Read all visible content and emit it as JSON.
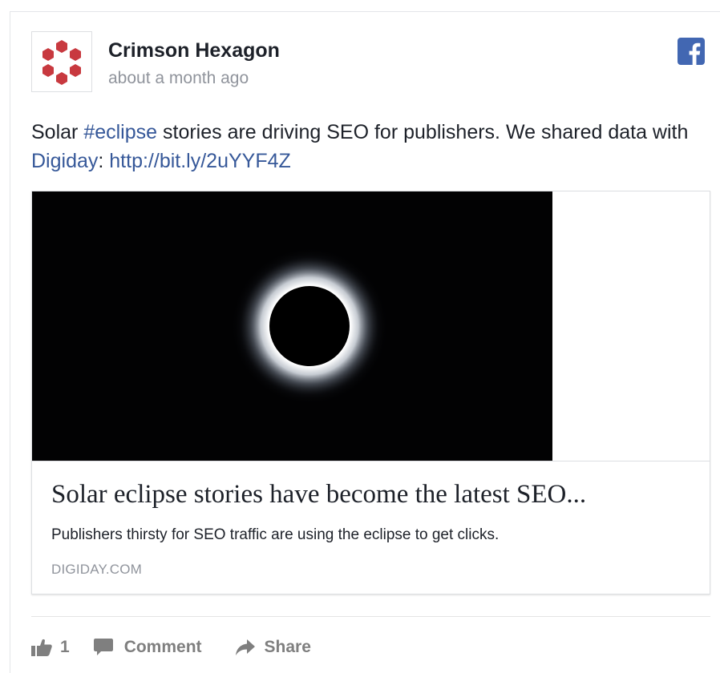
{
  "post": {
    "author": "Crimson Hexagon",
    "timestamp": "about a month ago",
    "text": {
      "part1": "Solar ",
      "hashtag": "#eclipse",
      "part2": " stories are driving SEO for publishers. We shared data with ",
      "mention": "Digiday",
      "part3": ": ",
      "link": "http://bit.ly/2uYYF4Z"
    },
    "source_icon": "facebook-icon",
    "avatar_icon": "crimson-hexagon-logo"
  },
  "link_card": {
    "image": "solar-eclipse-photo",
    "title": "Solar eclipse stories have become the latest SEO...",
    "description": "Publishers thirsty for SEO traffic are using the eclipse to get clicks.",
    "domain": "DIGIDAY.COM"
  },
  "actions": {
    "like_count": "1",
    "comment_label": "Comment",
    "share_label": "Share",
    "like_icon": "thumbs-up-icon",
    "comment_icon": "speech-bubble-icon",
    "share_icon": "share-arrow-icon"
  },
  "colors": {
    "link": "#365899",
    "text": "#1d2129",
    "muted": "#90949c",
    "facebook_blue": "#4267b2",
    "logo_red": "#c8393f",
    "action_gray": "#7f7f7f"
  }
}
